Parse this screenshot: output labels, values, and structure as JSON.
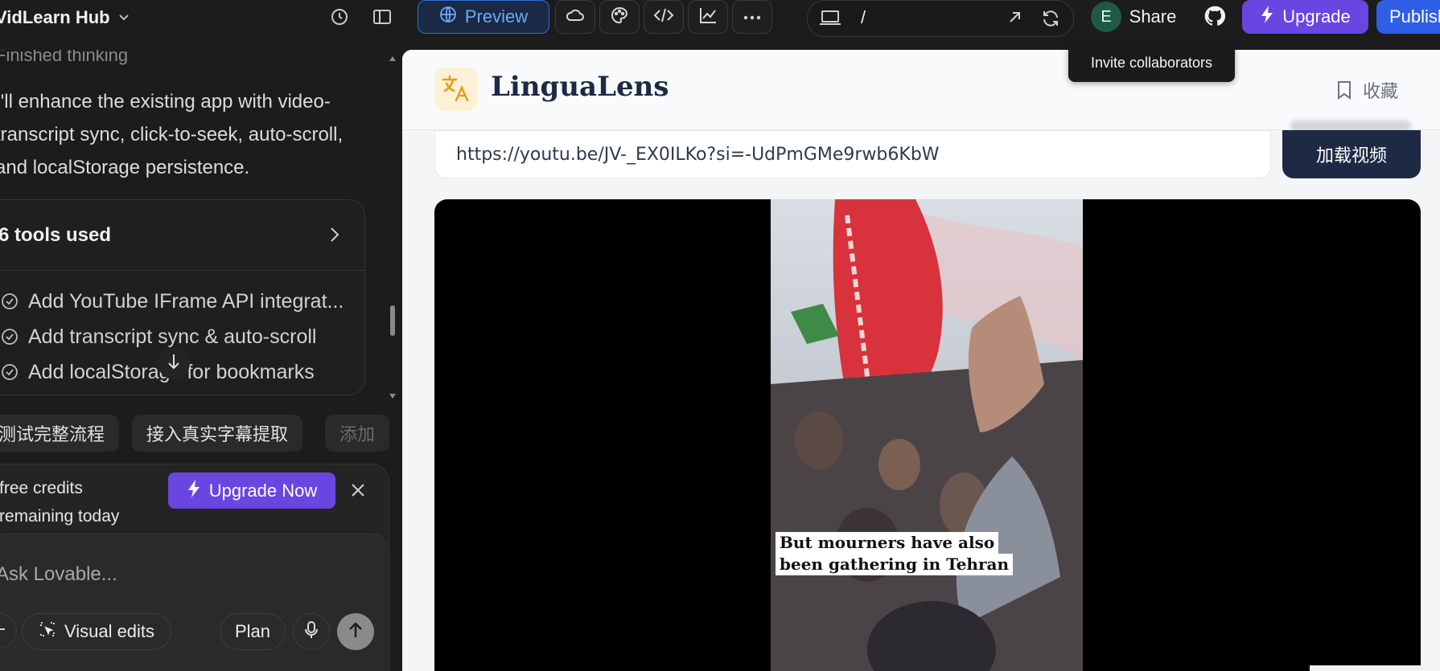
{
  "topbar": {
    "project_name": "VidLearn Hub",
    "preview_label": "Preview",
    "url_path": "/",
    "avatar_letter": "E",
    "share_label": "Share",
    "upgrade_label": "Upgrade",
    "publish_label": "Publish",
    "tooltip": "Invite collaborators"
  },
  "chat": {
    "thinking_label": "Finished thinking",
    "message": "I'll enhance the existing app with video-transcript sync, click-to-seek, auto-scroll, and localStorage persistence.",
    "tools_header": "6 tools used",
    "tools": [
      {
        "label": "Add YouTube IFrame API integrat..."
      },
      {
        "label": "Add transcript sync & auto-scroll"
      },
      {
        "label": "Add localStorage for bookmarks"
      }
    ],
    "chips": [
      "测试完整流程",
      "接入真实字幕提取",
      "添加"
    ],
    "credits_text_line1": "free credits",
    "credits_text_line2": "remaining today",
    "upgrade_now_label": "Upgrade Now",
    "composer_placeholder": "Ask Lovable...",
    "visual_edits_label": "Visual edits",
    "plan_label": "Plan"
  },
  "app": {
    "title": "LinguaLens",
    "bookmark_label": "收藏",
    "url_value": "https://youtu.be/JV-_EX0ILKo?si=-UdPmGMe9rwb6KbW",
    "load_button": "加载视频",
    "subtitle_line1": "But mourners have also",
    "subtitle_line2": "been gathering in Tehran"
  },
  "colors": {
    "accent_purple": "#6a45e0",
    "publish_blue": "#2e5fe6",
    "preview_blue": "#6ea8ff",
    "app_navy": "#1e2a44"
  },
  "icons": [
    "chevron-down-icon",
    "history-icon",
    "sidebar-toggle-icon",
    "globe-icon",
    "cloud-icon",
    "palette-icon",
    "code-icon",
    "chart-icon",
    "more-icon",
    "device-icon",
    "external-link-icon",
    "refresh-icon",
    "github-icon",
    "lightning-icon",
    "check-circle-icon",
    "chevron-right-icon",
    "arrow-down-icon",
    "close-icon",
    "plus-icon",
    "visual-edit-icon",
    "mic-icon",
    "arrow-up-icon",
    "translate-icon",
    "bookmark-icon"
  ]
}
